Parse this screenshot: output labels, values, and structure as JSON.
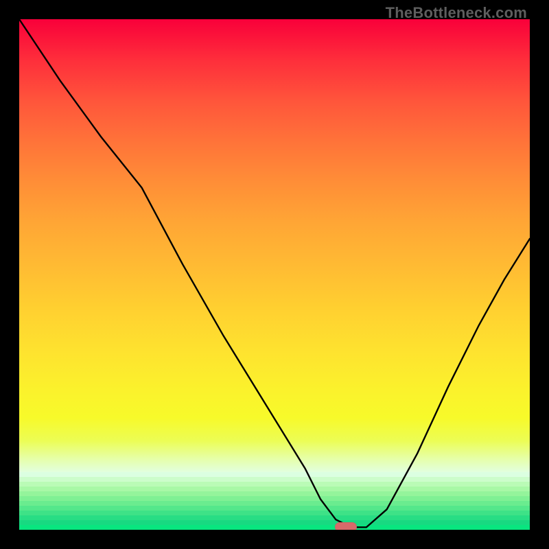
{
  "watermark": "TheBottleneck.com",
  "chart_data": {
    "type": "line",
    "title": "",
    "xlabel": "",
    "ylabel": "",
    "xlim": [
      0,
      100
    ],
    "ylim": [
      0,
      100
    ],
    "series": [
      {
        "name": "bottleneck-curve",
        "x": [
          0,
          8,
          16,
          24,
          32,
          40,
          48,
          56,
          59,
          62,
          65,
          68,
          72,
          78,
          84,
          90,
          95,
          100
        ],
        "values": [
          100,
          88,
          77,
          67,
          52,
          38,
          25,
          12,
          6,
          2,
          0.5,
          0.5,
          4,
          15,
          28,
          40,
          49,
          57
        ]
      }
    ],
    "legend": [],
    "grid": false,
    "marker": {
      "x": 64,
      "y": 0.5
    },
    "background_gradient": {
      "stops": [
        {
          "pct": 0,
          "color": "#f9003a"
        },
        {
          "pct": 50,
          "color": "#ffbc33"
        },
        {
          "pct": 88,
          "color": "#f7fa2a"
        },
        {
          "pct": 100,
          "color": "#09e57f"
        }
      ]
    },
    "green_bands": [
      "#dbffe1",
      "#ccfdcb",
      "#bafbb6",
      "#a8f8a6",
      "#94f49b",
      "#7ff094",
      "#6aec8f",
      "#54e78b",
      "#3ee287",
      "#28dd84",
      "#18d981",
      "#09e57f"
    ]
  }
}
